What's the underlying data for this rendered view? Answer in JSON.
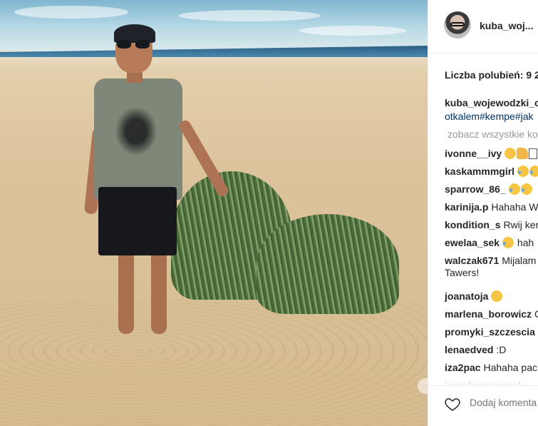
{
  "post": {
    "username": "kuba_woj...",
    "likes_label": "Liczba polubień: 9 2",
    "caption_user": "kuba_wojewodzki_c",
    "caption_tags": "otkalem#kempe#jak",
    "see_all_comments": "zobacz wszystkie ko",
    "comment_placeholder": "Dodaj komenta"
  },
  "comments": [
    {
      "user": "ivonne__ivy",
      "text": "",
      "emoji": [
        "grin",
        "thumb",
        "box"
      ]
    },
    {
      "user": "kaskammmgirl",
      "text": "",
      "emoji": [
        "tear",
        "tear"
      ]
    },
    {
      "user": "sparrow_86_",
      "text": "",
      "emoji": [
        "tear",
        "tear"
      ]
    },
    {
      "user": "karinija.p",
      "text": "Hahaha W",
      "emoji": []
    },
    {
      "user": "kondition_s",
      "text": "Rwij ker",
      "emoji": []
    },
    {
      "user": "ewelaa_sek",
      "text": "hah",
      "emoji": [
        "sweat"
      ]
    },
    {
      "user": "walczak671",
      "text": "Mijalam",
      "text2": "Tawers!",
      "emoji": []
    },
    {
      "user": "joanatoja",
      "text": "",
      "emoji": [
        "grin"
      ]
    },
    {
      "user": "marlena_borowicz",
      "text": "C",
      "emoji": []
    },
    {
      "user": "promyki_szczescia",
      "text": "r",
      "emoji": []
    },
    {
      "user": "lenaedved",
      "text": ":D",
      "emoji": []
    },
    {
      "user": "iza2pac",
      "text": "Hahaha pac",
      "emoji": []
    },
    {
      "user": "jagodaczymczak",
      "text": "",
      "emoji": []
    }
  ],
  "icons": {
    "heart": "heart-outline-icon",
    "avatar": "avatar"
  },
  "colors": {
    "link": "#003569",
    "text": "#262626",
    "muted": "#999999"
  }
}
